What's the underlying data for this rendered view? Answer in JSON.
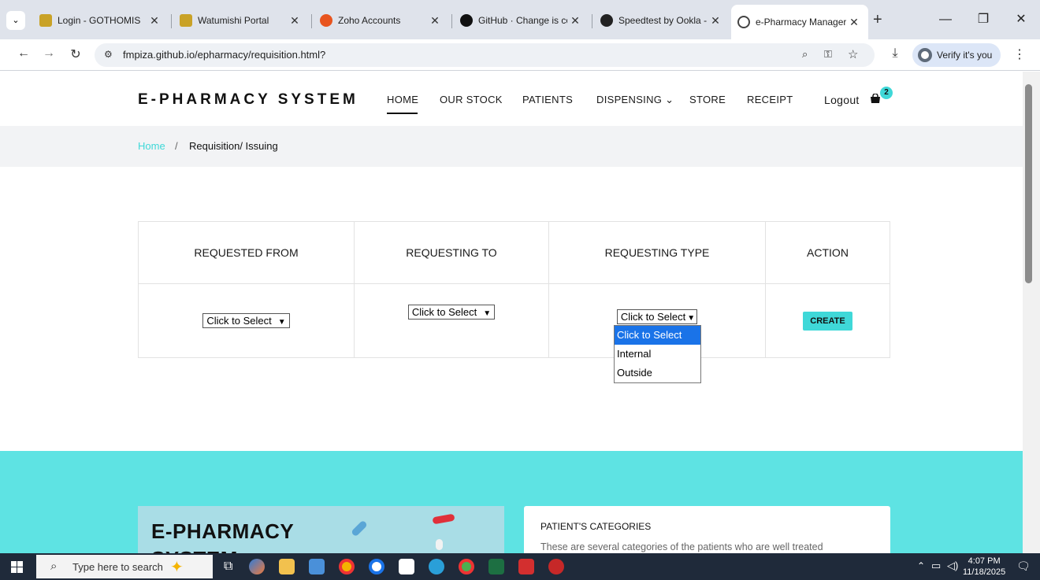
{
  "browser": {
    "tabs": [
      {
        "title": "Login - GOTHOMIS",
        "color": "#c9a227"
      },
      {
        "title": "Watumishi Portal",
        "color": "#c9a227"
      },
      {
        "title": "Zoho Accounts",
        "color": "#e8541e"
      },
      {
        "title": "GitHub · Change is co",
        "color": "#111111"
      },
      {
        "title": "Speedtest by Ookla -",
        "color": "#222222"
      },
      {
        "title": "e-Pharmacy Manager",
        "color": "#444444"
      }
    ],
    "new_tab": "+",
    "url": "fmpiza.github.io/epharmacy/requisition.html?",
    "verify_label": "Verify it's you"
  },
  "site": {
    "brand": "E-PHARMACY SYSTEM",
    "nav": {
      "home": "HOME",
      "stock": "OUR STOCK",
      "patients": "PATIENTS",
      "dispensing": "DISPENSING ⌄",
      "store": "STORE",
      "receipt": "RECEIPT",
      "logout": "Logout"
    },
    "cart_count": "2",
    "breadcrumb": {
      "home": "Home",
      "separator": "/",
      "current": "Requisition/ Issuing"
    },
    "table": {
      "headers": [
        "REQUESTED FROM",
        "REQUESTING TO",
        "REQUESTING TYPE",
        "ACTION"
      ],
      "select_placeholder": "Click to Select",
      "create_label": "CREATE"
    },
    "dropdown_options": [
      "Click to Select",
      "Internal",
      "Outside"
    ],
    "hero": {
      "title_line1": "E-PHARMACY",
      "title_line2": "SYSTEM",
      "info_title": "PATIENT'S CATEGORIES",
      "info_text": "These are several categories of the patients who are well treated"
    },
    "accent_color": "#3fd8d8"
  },
  "taskbar": {
    "search_placeholder": "Type here to search",
    "time": "4:07 PM",
    "date": "11/18/2025"
  }
}
